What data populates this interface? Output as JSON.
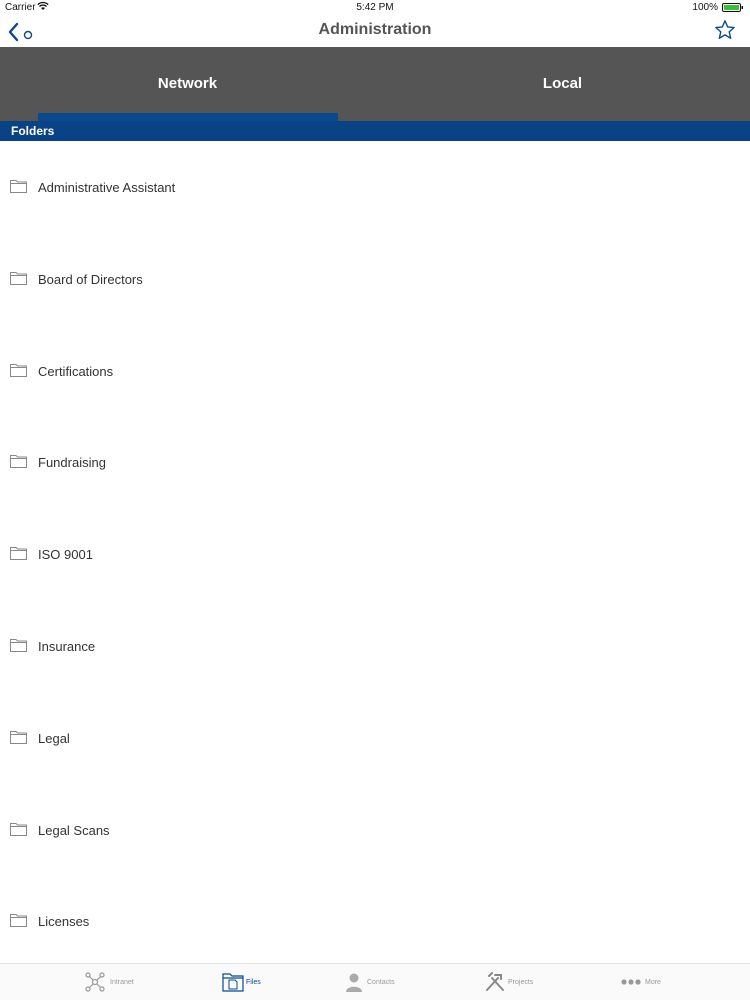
{
  "status_bar": {
    "carrier": "Carrier",
    "time": "5:42 PM",
    "battery": "100%"
  },
  "nav": {
    "title": "Administration",
    "back_icon": "chevron-left-icon",
    "favorite_icon": "star-icon"
  },
  "tabs": [
    {
      "label": "Network",
      "selected": true
    },
    {
      "label": "Local",
      "selected": false
    }
  ],
  "section": {
    "title": "Folders"
  },
  "folders": [
    "Administrative Assistant",
    "Board of Directors",
    "Certifications",
    "Fundraising",
    "ISO 9001",
    "Insurance",
    "Legal",
    "Legal Scans",
    "Licenses"
  ],
  "tab_bar": {
    "items": [
      {
        "label": "Intranet",
        "icon": "network-icon",
        "active": false
      },
      {
        "label": "Files",
        "icon": "files-icon",
        "active": true
      },
      {
        "label": "Contacts",
        "icon": "person-icon",
        "active": false
      },
      {
        "label": "Projects",
        "icon": "tools-icon",
        "active": false
      },
      {
        "label": "More",
        "icon": "more-icon",
        "active": false
      }
    ]
  },
  "colors": {
    "accent": "#0a4286",
    "tab_bg": "#555555",
    "indicator": "#0a4a8c"
  }
}
